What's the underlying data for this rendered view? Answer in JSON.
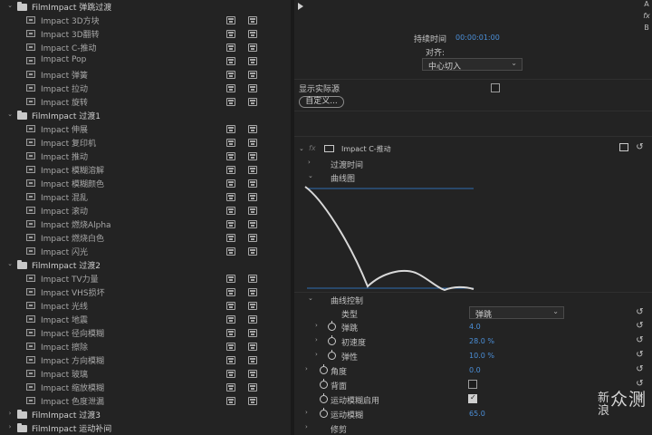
{
  "effects_tree": [
    {
      "kind": "folder",
      "label": "FilmImpact 弹跳过渡",
      "open": true
    },
    {
      "kind": "item",
      "label": "Impact 3D方块"
    },
    {
      "kind": "item",
      "label": "Impact 3D翻转"
    },
    {
      "kind": "item",
      "label": "Impact C-推动"
    },
    {
      "kind": "item",
      "label": "Impact Pop"
    },
    {
      "kind": "item",
      "label": "Impact 弹簧"
    },
    {
      "kind": "item",
      "label": "Impact 拉动"
    },
    {
      "kind": "item",
      "label": "Impact 旋转"
    },
    {
      "kind": "folder",
      "label": "FilmImpact 过渡1",
      "open": true
    },
    {
      "kind": "item",
      "label": "Impact 伸展"
    },
    {
      "kind": "item",
      "label": "Impact 复印机"
    },
    {
      "kind": "item",
      "label": "Impact 推动"
    },
    {
      "kind": "item",
      "label": "Impact 模糊溶解"
    },
    {
      "kind": "item",
      "label": "Impact 模糊颜色"
    },
    {
      "kind": "item",
      "label": "Impact 混乱"
    },
    {
      "kind": "item",
      "label": "Impact 滚动"
    },
    {
      "kind": "item",
      "label": "Impact 燃烧Alpha"
    },
    {
      "kind": "item",
      "label": "Impact 燃烧白色"
    },
    {
      "kind": "item",
      "label": "Impact 闪光"
    },
    {
      "kind": "folder",
      "label": "FilmImpact 过渡2",
      "open": true
    },
    {
      "kind": "item",
      "label": "Impact TV力量"
    },
    {
      "kind": "item",
      "label": "Impact VHS损坏"
    },
    {
      "kind": "item",
      "label": "Impact 光线"
    },
    {
      "kind": "item",
      "label": "Impact 地震"
    },
    {
      "kind": "item",
      "label": "Impact 径向模糊"
    },
    {
      "kind": "item",
      "label": "Impact 擦除"
    },
    {
      "kind": "item",
      "label": "Impact 方向模糊"
    },
    {
      "kind": "item",
      "label": "Impact 玻璃"
    },
    {
      "kind": "item",
      "label": "Impact 缩放模糊"
    },
    {
      "kind": "item",
      "label": "Impact 色度泄漏"
    },
    {
      "kind": "folder",
      "label": "FilmImpact 过渡3",
      "open": false
    },
    {
      "kind": "folder",
      "label": "FilmImpact 运动补间",
      "open": false
    }
  ],
  "right_strip": [
    "A",
    "fx",
    "B"
  ],
  "duration": {
    "label": "持续时间",
    "value": "00:00:01:00"
  },
  "alignment": {
    "label": "对齐:",
    "value": "中心切入"
  },
  "show_source": {
    "label": "显示实际源",
    "checked": false
  },
  "custom_button": "自定义...",
  "effect": {
    "tag": "fx",
    "name": "Impact C-推动"
  },
  "params": {
    "transition_time": "过渡时间",
    "curve": "曲线图",
    "curve_control": "曲线控制",
    "type_label": "类型",
    "type_value": "弹跳",
    "bounce_label": "弹跳",
    "bounce_value": "4.0",
    "velocity_label": "初速度",
    "velocity_value": "28.0 %",
    "elastic_label": "弹性",
    "elastic_value": "10.0 %",
    "angle_label": "角度",
    "angle_value": "0.0",
    "back_label": "背面",
    "back_checked": false,
    "mb_enable_label": "运动模糊启用",
    "mb_enable_checked": true,
    "mb_label": "运动模糊",
    "mb_value": "65.0",
    "clip_label": "修剪"
  },
  "watermark": {
    "line1": "新",
    "line2": "浪",
    "brand": "众测"
  },
  "colors": {
    "background": "#232323",
    "value_blue": "#4b8fd8",
    "curve": "#d9d9d9",
    "guide": "#2f6db0"
  }
}
